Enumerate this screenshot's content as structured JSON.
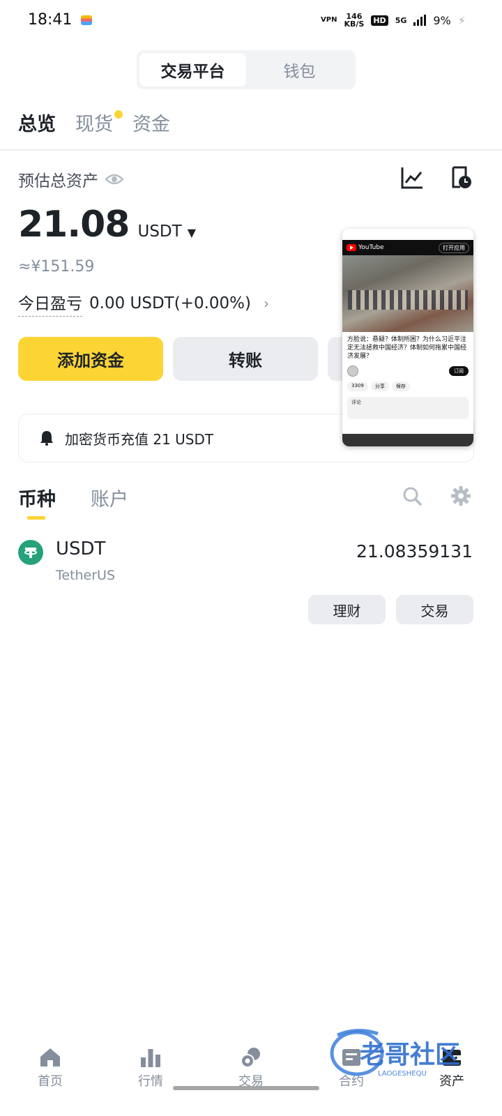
{
  "status_bar": {
    "time": "18:41",
    "vpn": "VPN",
    "speed_value": "146",
    "speed_unit": "KB/S",
    "hd": "HD",
    "network": "5G",
    "battery": "9%"
  },
  "top_switch": {
    "items": [
      "交易平台",
      "钱包"
    ],
    "active_index": 0
  },
  "sub_tabs": {
    "items": [
      "总览",
      "现货",
      "资金"
    ],
    "active_index": 0
  },
  "overview": {
    "label": "预估总资产",
    "balance": "21.08",
    "unit": "USDT",
    "fiat": "≈¥151.59",
    "pnl_label": "今日盈亏",
    "pnl_value": "0.00 USDT(+0.00%)"
  },
  "actions": {
    "deposit": "添加资金",
    "transfer": "转账"
  },
  "notice": {
    "text": "加密货币充值 21 USDT"
  },
  "pip_video": {
    "brand": "YouTube",
    "open_app": "打开应用",
    "title": "方脸说：悬疑？体制所困？为什么习近平注定无法拯救中国经济？体制如何拖累中国经济发展？",
    "subscribe": "订阅",
    "likes": "3309",
    "share": "分享",
    "save": "保存",
    "comments_label": "评论"
  },
  "list_tabs": {
    "items": [
      "币种",
      "账户"
    ],
    "active_index": 0
  },
  "coins": [
    {
      "symbol": "USDT",
      "name": "TetherUS",
      "amount": "21.08359131",
      "earn": "理财",
      "trade": "交易"
    }
  ],
  "bottom_nav": {
    "items": [
      {
        "label": "首页",
        "icon": "home-icon"
      },
      {
        "label": "行情",
        "icon": "bar-chart-icon"
      },
      {
        "label": "交易",
        "icon": "trade-icon"
      },
      {
        "label": "合约",
        "icon": "futures-icon"
      },
      {
        "label": "资产",
        "icon": "wallet-icon"
      }
    ],
    "active_index": 4
  },
  "watermark": {
    "text": "老哥社区",
    "subtext": "LAOGESHEQU"
  },
  "colors": {
    "accent": "#fcd535",
    "tether": "#26a17b",
    "text": "#1e2329",
    "muted": "#848e9c"
  }
}
